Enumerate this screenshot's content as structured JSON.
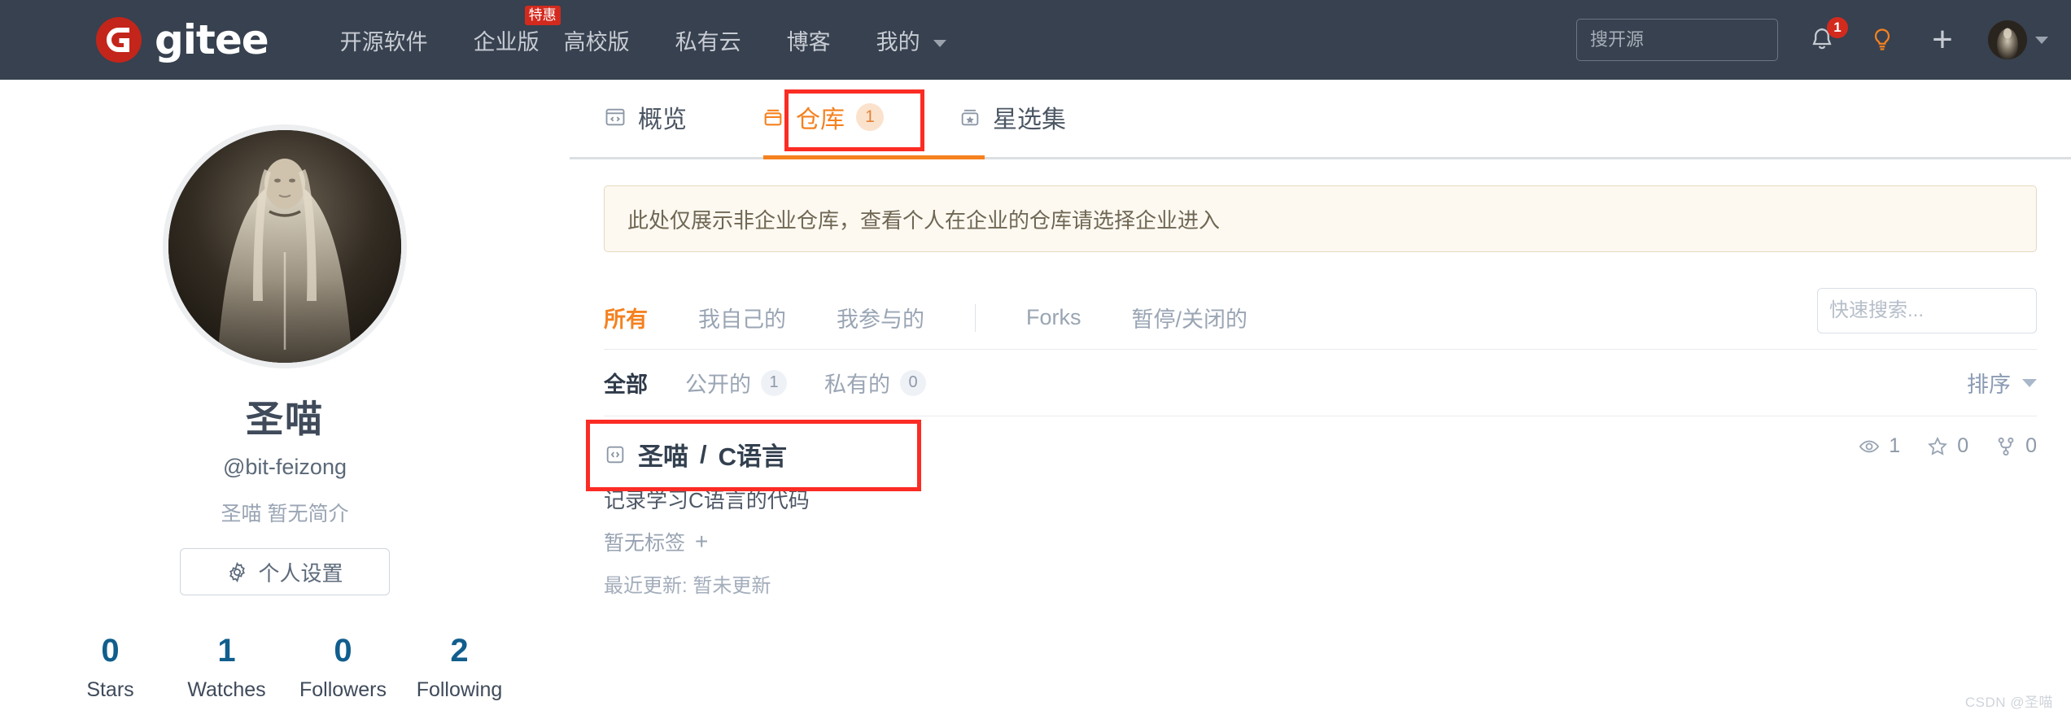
{
  "topnav": {
    "brand": "gitee",
    "brand_logo_icon": "gitee-g-logo-icon",
    "links": [
      {
        "label": "开源软件",
        "badge": null
      },
      {
        "label": "企业版",
        "badge": "特惠"
      },
      {
        "label": "高校版",
        "badge": null
      },
      {
        "label": "私有云",
        "badge": null
      },
      {
        "label": "博客",
        "badge": null
      },
      {
        "label": "我的",
        "badge": null,
        "has_caret": true
      }
    ],
    "search": {
      "placeholder": "搜开源",
      "value": ""
    },
    "notification_icon": "bell-icon",
    "notification_count": "1",
    "lightbulb_icon": "lightbulb-icon",
    "plus_icon": "plus-icon",
    "avatar_icon": "user-avatar",
    "avatar_caret_icon": "chevron-down-icon"
  },
  "profile": {
    "avatar_name": "profile-avatar",
    "name": "圣喵",
    "handle": "@bit-feizong",
    "bio": "圣喵 暂无简介",
    "settings_button": "个人设置",
    "settings_icon": "gear-icon",
    "stats": [
      {
        "value": "0",
        "label": "Stars"
      },
      {
        "value": "1",
        "label": "Watches"
      },
      {
        "value": "0",
        "label": "Followers"
      },
      {
        "value": "2",
        "label": "Following"
      }
    ]
  },
  "tabs": [
    {
      "label": "概览",
      "icon": "code-square-icon",
      "count": null,
      "active": false
    },
    {
      "label": "仓库",
      "icon": "repo-box-icon",
      "count": "1",
      "active": true
    },
    {
      "label": "星选集",
      "icon": "star-box-icon",
      "count": null,
      "active": false
    }
  ],
  "notice": {
    "text": "此处仅展示非企业仓库，查看个人在企业的仓库请选择企业进入"
  },
  "filters": [
    {
      "label": "所有",
      "active": true
    },
    {
      "label": "我自己的",
      "active": false
    },
    {
      "label": "我参与的",
      "active": false
    },
    {
      "label": "Forks",
      "active": false
    },
    {
      "label": "暂停/关闭的",
      "active": false
    }
  ],
  "quick_search": {
    "placeholder": "快速搜索...",
    "value": "",
    "icon": "search-icon"
  },
  "subfilters": [
    {
      "label": "全部",
      "count": null,
      "active": true
    },
    {
      "label": "公开的",
      "count": "1",
      "active": false
    },
    {
      "label": "私有的",
      "count": "0",
      "active": false
    }
  ],
  "sort": {
    "label": "排序",
    "icon": "chevron-down-icon"
  },
  "repos": [
    {
      "icon": "code-repo-icon",
      "owner": "圣喵",
      "separator": "/",
      "name": "C语言",
      "description": "记录学习C语言的代码",
      "tags_label": "暂无标签",
      "add_tag_icon": "plus-icon",
      "updated_label": "最近更新:",
      "updated_value": "暂未更新",
      "watch_icon": "eye-icon",
      "watch_count": "1",
      "star_icon": "star-icon",
      "star_count": "0",
      "fork_icon": "fork-icon",
      "fork_count": "0"
    }
  ],
  "watermark": "CSDN @圣喵",
  "colors": {
    "nav_bg": "#37414f",
    "brand_red": "#c3251b",
    "accent_orange": "#f5811f",
    "highlight_red": "#fb2c24",
    "stat_blue": "#115e8d",
    "notice_bg": "#fdf9f1"
  }
}
